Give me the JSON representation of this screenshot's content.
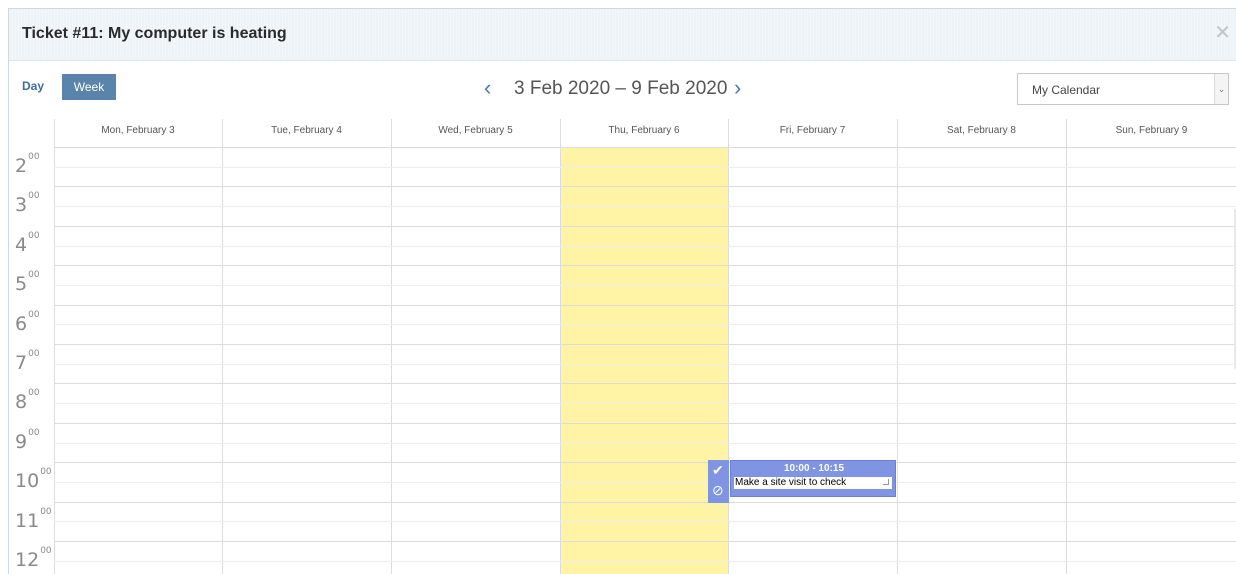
{
  "dialog": {
    "title": "Ticket #11: My computer is heating"
  },
  "toolbar": {
    "day_label": "Day",
    "week_label": "Week",
    "date_range": "3 Feb 2020 – 9 Feb 2020",
    "calendar_select": "My Calendar"
  },
  "days": [
    "Mon, February 3",
    "Tue, February 4",
    "Wed, February 5",
    "Thu, February 6",
    "Fri, February 7",
    "Sat, February 8",
    "Sun, February 9"
  ],
  "hours": [
    {
      "h": "2",
      "m": "00"
    },
    {
      "h": "3",
      "m": "00"
    },
    {
      "h": "4",
      "m": "00"
    },
    {
      "h": "5",
      "m": "00"
    },
    {
      "h": "6",
      "m": "00"
    },
    {
      "h": "7",
      "m": "00"
    },
    {
      "h": "8",
      "m": "00"
    },
    {
      "h": "9",
      "m": "00"
    },
    {
      "h": "10",
      "m": "00"
    },
    {
      "h": "11",
      "m": "00"
    },
    {
      "h": "12",
      "m": "00"
    }
  ],
  "event": {
    "time": "10:00 - 10:15",
    "text": "Make a site visit to check"
  },
  "colors": {
    "today_highlight": "#fff3a6",
    "event": "#7f94e2",
    "week_button": "#5b84ad"
  }
}
